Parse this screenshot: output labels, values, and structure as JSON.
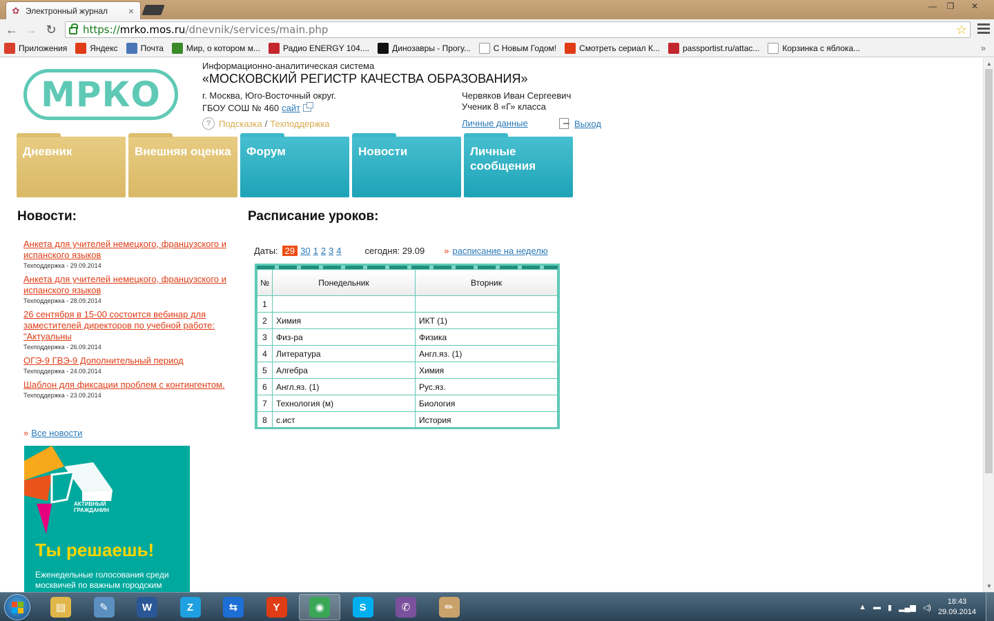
{
  "browser": {
    "tab_title": "Электронный журнал",
    "url_scheme": "https://",
    "url_host": "mrko.mos.ru",
    "url_path": "/dnevnik/services/main.php",
    "bookmarks": [
      {
        "label": "Приложения",
        "icon": "apps-grid-icon",
        "color": "#d9402b"
      },
      {
        "label": "Яндекс",
        "icon": "yandex-icon",
        "color": "#e03c16"
      },
      {
        "label": "Почта",
        "icon": "mail-icon",
        "color": "#4a76b8"
      },
      {
        "label": "Мир, о котором м...",
        "icon": "angry-birds-icon",
        "color": "#3b8a2a"
      },
      {
        "label": "Радио ENERGY 104....",
        "icon": "guitar-icon",
        "color": "#c4262e"
      },
      {
        "label": "Динозавры - Прогу...",
        "icon": "bbc-icon",
        "color": "#111111"
      },
      {
        "label": "С Новым Годом!",
        "icon": "page-icon",
        "color": "#ffffff"
      },
      {
        "label": "Смотреть сериал К...",
        "icon": "ctc-icon",
        "color": "#e03c16"
      },
      {
        "label": "passportist.ru/attac...",
        "icon": "bookmark-red-icon",
        "color": "#c4262e"
      },
      {
        "label": "Корзинка с яблока...",
        "icon": "basket-icon",
        "color": "#ffffff"
      }
    ]
  },
  "header": {
    "logo_text": "МРКО",
    "org_subtitle": "Информационно-аналитическая система",
    "org_title": "«МОСКОВСКИЙ РЕГИСТР КАЧЕСТВА ОБРАЗОВАНИЯ»",
    "city": "г. Москва, Юго-Восточный округ.",
    "school": "ГБОУ СОШ № 460",
    "site_link": "сайт",
    "help": "Подсказка",
    "help_sep": "/",
    "support": "Техподдержка",
    "user_name": "Червяков Иван Сергеевич",
    "user_class": "Ученик 8 «Г» класса",
    "personal_data": "Личные данные",
    "logout": "Выход"
  },
  "nav": [
    {
      "label": "Дневник",
      "style": "gold"
    },
    {
      "label": "Внешняя оценка",
      "style": "gold"
    },
    {
      "label": "Форум",
      "style": "teal"
    },
    {
      "label": "Новости",
      "style": "teal"
    },
    {
      "label": "Личные сообщения",
      "style": "teal"
    }
  ],
  "news": {
    "heading": "Новости:",
    "items": [
      {
        "title": "Анкета для учителей немецкого, французского и испанского языков",
        "meta": "Техподдержка - 29.09.2014"
      },
      {
        "title": "Анкета для учителей немецкого, французского и испанского языков",
        "meta": "Техподдержка - 28.09.2014"
      },
      {
        "title": "26 сентября в 15-00 состоится вебинар для заместителей директоров по учебной работе: \"Актуальны",
        "meta": "Техподдержка - 26.09.2014"
      },
      {
        "title": "ОГЭ-9 ГВЭ-9 Дополнительный период",
        "meta": "Техподдержка - 24.09.2014"
      },
      {
        "title": "Шаблон для фиксации проблем с контингентом.",
        "meta": "Техподдержка - 23.09.2014"
      }
    ],
    "all_news": "Все новости",
    "raquo": "»"
  },
  "banner": {
    "brand_line1": "АКТИВНЫЙ",
    "brand_line2": "ГРАЖДАНИН",
    "slogan": "Ты решаешь!",
    "desc": "Еженедельные голосования среди москвичей по важным городским"
  },
  "schedule": {
    "heading": "Расписание уроков:",
    "dates_label": "Даты:",
    "dates": [
      "29",
      "30",
      "1",
      "2",
      "3",
      "4"
    ],
    "active_date": "29",
    "today": "сегодня: 29.09",
    "week_link": "расписание на неделю",
    "raquo": "»",
    "columns": [
      "№",
      "Понедельник",
      "Вторник"
    ],
    "rows": [
      [
        "1",
        "",
        ""
      ],
      [
        "2",
        "Химия",
        "ИКТ (1)"
      ],
      [
        "3",
        "Физ-ра",
        "Физика"
      ],
      [
        "4",
        "Литература",
        "Англ.яз. (1)"
      ],
      [
        "5",
        "Алгебра",
        "Химия"
      ],
      [
        "6",
        "Англ.яз. (1)",
        "Рус.яз."
      ],
      [
        "7",
        "Технология (м)",
        "Биология"
      ],
      [
        "8",
        "с.ист",
        "История"
      ]
    ]
  },
  "taskbar": {
    "apps": [
      {
        "name": "explorer-icon",
        "color": "#e0b64a",
        "glyph": "▤"
      },
      {
        "name": "scanner-icon",
        "color": "#5a8fc0",
        "glyph": "✎"
      },
      {
        "name": "word-icon",
        "color": "#2b5797",
        "glyph": "W"
      },
      {
        "name": "zello-icon",
        "color": "#1fa0e0",
        "glyph": "Z"
      },
      {
        "name": "teamviewer-icon",
        "color": "#1d6fd6",
        "glyph": "⇆"
      },
      {
        "name": "yandex-browser-icon",
        "color": "#e03c16",
        "glyph": "Y"
      },
      {
        "name": "chrome-icon",
        "color": "#3aa757",
        "glyph": "◉"
      },
      {
        "name": "skype-icon",
        "color": "#00aff0",
        "glyph": "S"
      },
      {
        "name": "viber-icon",
        "color": "#7b519d",
        "glyph": "✆"
      },
      {
        "name": "paint-icon",
        "color": "#c9a26b",
        "glyph": "✏"
      }
    ],
    "active_app": "chrome-icon",
    "time": "18:43",
    "date": "29.09.2014"
  }
}
